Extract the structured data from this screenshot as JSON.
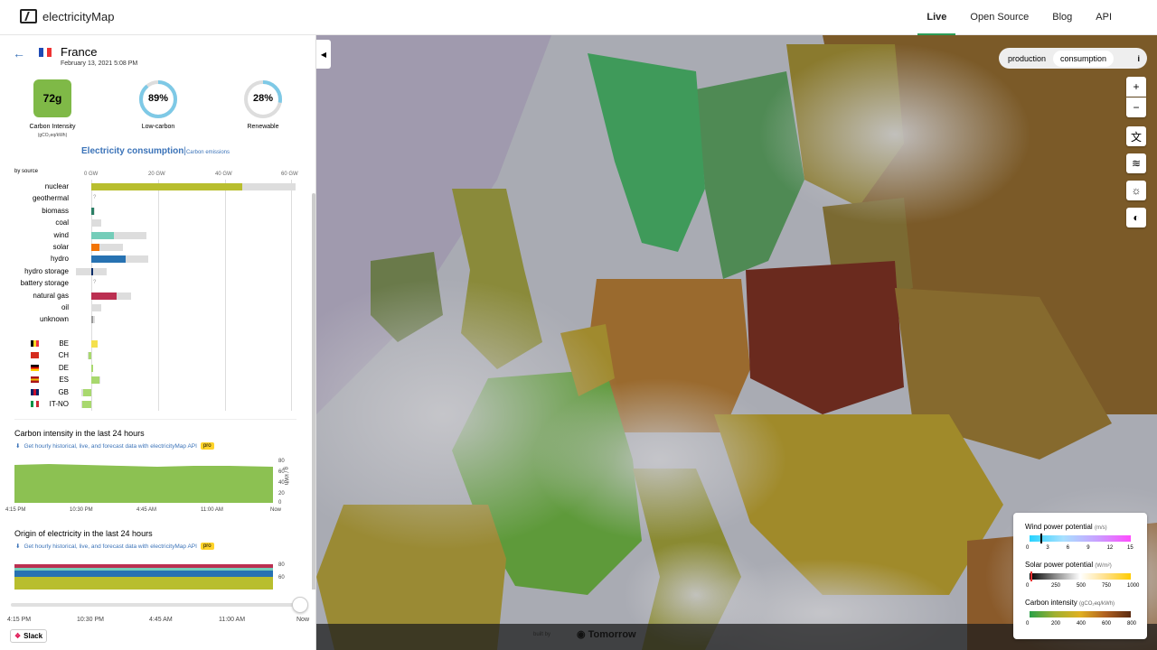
{
  "app": {
    "name": "electricityMap"
  },
  "nav": [
    "Live",
    "Open Source",
    "Blog",
    "API"
  ],
  "zone": {
    "name": "France",
    "date": "February 13, 2021 5:08 PM"
  },
  "kpi": {
    "carbon_intensity": "72g",
    "carbon_intensity_label": "Carbon Intensity",
    "carbon_intensity_unit": "(gCO₂eq/kWh)",
    "low_carbon": "89%",
    "low_carbon_label": "Low-carbon",
    "low_carbon_fraction": 0.89,
    "renewable": "28%",
    "renewable_label": "Renewable",
    "renewable_fraction": 0.28
  },
  "tabs": {
    "active": "Electricity consumption",
    "other": "Carbon emissions"
  },
  "breakdown": {
    "by_source": "by source",
    "axis": [
      "0 GW",
      "20 GW",
      "40 GW",
      "60 GW"
    ],
    "sources": [
      {
        "label": "nuclear",
        "value": 45,
        "capacity": 61,
        "color": "#b8be2e"
      },
      {
        "label": "geothermal",
        "value": null,
        "capacity": null,
        "color": "#999"
      },
      {
        "label": "biomass",
        "value": 0.8,
        "capacity": 1.0,
        "color": "#2b7f65"
      },
      {
        "label": "coal",
        "value": 0,
        "capacity": 3,
        "color": "#999"
      },
      {
        "label": "wind",
        "value": 6.8,
        "capacity": 16.5,
        "color": "#74cdb9"
      },
      {
        "label": "solar",
        "value": 2.5,
        "capacity": 9.5,
        "color": "#f27406"
      },
      {
        "label": "hydro",
        "value": 10.3,
        "capacity": 17,
        "color": "#2772b2"
      },
      {
        "label": "hydro storage",
        "value": 0.5,
        "capacity": 4.5,
        "neg_capacity": 4.5,
        "color": "#0b2e6a"
      },
      {
        "label": "battery storage",
        "value": null,
        "capacity": null,
        "color": "#999"
      },
      {
        "label": "natural gas",
        "value": 7.5,
        "capacity": 12,
        "color": "#bb2f51"
      },
      {
        "label": "oil",
        "value": 0,
        "capacity": 3,
        "color": "#999"
      },
      {
        "label": "unknown",
        "value": 0.3,
        "capacity": 1,
        "color": "#999"
      }
    ],
    "exchanges": [
      {
        "label": "BE",
        "value": 1.8,
        "capacity": 2
      },
      {
        "label": "CH",
        "value": -0.8,
        "capacity": 1
      },
      {
        "label": "DE",
        "value": 0.2,
        "capacity": 0.2
      },
      {
        "label": "ES",
        "value": 2.5,
        "capacity": 2.8
      },
      {
        "label": "GB",
        "value": -2.5,
        "capacity": 3
      },
      {
        "label": "IT-NO",
        "value": -2.8,
        "capacity": 3
      }
    ]
  },
  "ci_history": {
    "title": "Carbon intensity in the last 24 hours",
    "api_link": "Get hourly historical, live, and forecast data with electricityMap API",
    "pro": "pro",
    "y_ticks": [
      "80",
      "60",
      "40",
      "20",
      "0"
    ],
    "y_unit": "g / kWh",
    "x_ticks": [
      "4:15 PM",
      "10:30 PM",
      "4:45 AM",
      "11:00 AM",
      "Now"
    ]
  },
  "origin_history": {
    "title": "Origin of electricity in the last 24 hours",
    "api_link": "Get hourly historical, live, and forecast data with electricityMap API",
    "pro": "pro",
    "y_ticks": [
      "80",
      "60"
    ]
  },
  "timeline": {
    "ticks": [
      "4:15 PM",
      "10:30 PM",
      "4:45 AM",
      "11:00 AM",
      "Now"
    ]
  },
  "slack": "Slack",
  "map": {
    "toggle": {
      "production": "production",
      "consumption": "consumption",
      "info": "i"
    },
    "zoom_in": "+",
    "zoom_out": "−",
    "legend": {
      "wind": {
        "title": "Wind power potential",
        "unit": "(m/s)",
        "ticks": [
          "0",
          "3",
          "6",
          "9",
          "12",
          "15"
        ]
      },
      "solar": {
        "title": "Solar power potential",
        "unit": "(W/m²)",
        "ticks": [
          "0",
          "250",
          "500",
          "750",
          "1000"
        ]
      },
      "carbon": {
        "title": "Carbon intensity",
        "unit": "(gCO₂eq/kWh)",
        "ticks": [
          "0",
          "200",
          "400",
          "600",
          "800"
        ]
      }
    },
    "built_by": "built by",
    "partner": "Tomorrow"
  }
}
